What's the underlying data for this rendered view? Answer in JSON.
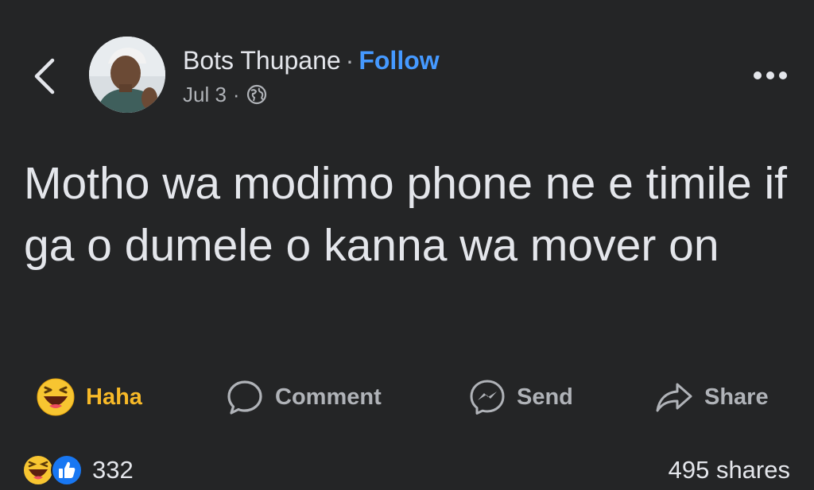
{
  "header": {
    "author_name": "Bots Thupane",
    "separator": "·",
    "follow_label": "Follow",
    "date": "Jul 3",
    "date_separator": "·",
    "privacy_icon": "globe-icon",
    "back_icon": "chevron-left-icon",
    "more_icon": "more-options-icon"
  },
  "post": {
    "text": "Motho wa modimo phone ne e timile if ga o dumele o kanna wa mover on"
  },
  "actions": {
    "haha_label": "Haha",
    "comment_label": "Comment",
    "send_label": "Send",
    "share_label": "Share"
  },
  "stats": {
    "reaction_count": "332",
    "shares": "495 shares",
    "reaction_icons": [
      "haha-icon",
      "like-icon"
    ]
  },
  "colors": {
    "background": "#242526",
    "text": "#e4e6eb",
    "muted": "#b0b3b8",
    "follow": "#4599ff",
    "haha": "#f7b928",
    "like": "#1877f2"
  }
}
